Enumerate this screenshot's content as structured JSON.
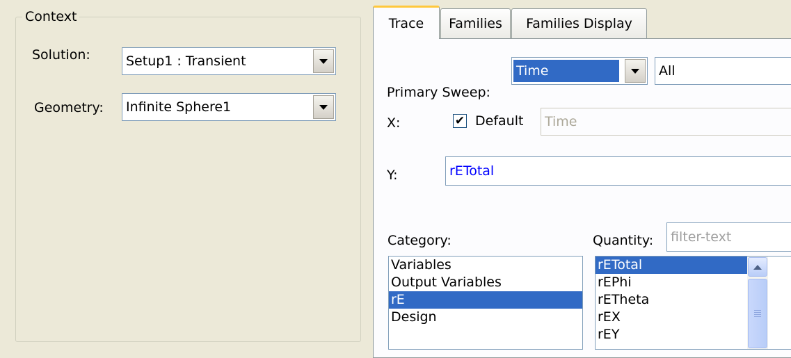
{
  "context": {
    "legend": "Context",
    "solution_label": "Solution:",
    "solution_value": "Setup1 : Transient",
    "geometry_label": "Geometry:",
    "geometry_value": "Infinite Sphere1"
  },
  "tabs": [
    {
      "label": "Trace",
      "active": true
    },
    {
      "label": "Families",
      "active": false
    },
    {
      "label": "Families Display",
      "active": false
    }
  ],
  "trace": {
    "primary_sweep_label": "Primary Sweep:",
    "primary_sweep_value": "Time",
    "sweep_range_value": "All",
    "x_label": "X:",
    "x_default_checked": true,
    "x_default_label": "Default",
    "x_value": "Time",
    "y_label": "Y:",
    "y_value": "rETotal",
    "category_label": "Category:",
    "categories": [
      "Variables",
      "Output Variables",
      "rE",
      "Design",
      ""
    ],
    "selected_category": "rE",
    "quantity_label": "Quantity:",
    "quantity_filter_placeholder": "filter-text",
    "quantities": [
      "rETotal",
      "rEPhi",
      "rETheta",
      "rEX",
      "rEY"
    ],
    "selected_quantity": "rETotal"
  },
  "colors": {
    "window_bg": "#ece9d8",
    "selection": "#316ac5",
    "tab_hot": "#ffc83c",
    "link_text": "#0000ff"
  }
}
